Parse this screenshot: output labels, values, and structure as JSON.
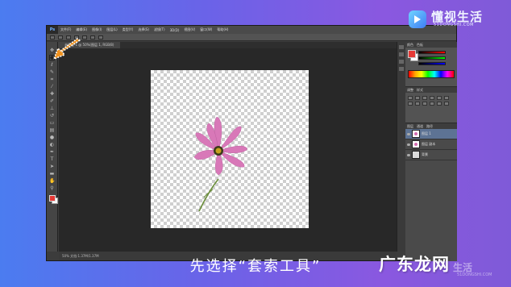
{
  "app": {
    "logo_text": "Ps",
    "menu": [
      "文件(F)",
      "编辑(E)",
      "图像(I)",
      "图层(L)",
      "类型(Y)",
      "选择(S)",
      "滤镜(T)",
      "3D(D)",
      "视图(V)",
      "窗口(W)",
      "帮助(H)"
    ],
    "document_tab": "未标题-1 @ 50%(图层 1, RGB/8)",
    "status": "50% 文档:1.37M/1.37M"
  },
  "panels": {
    "color_tabs": [
      "颜色",
      "色板"
    ],
    "adjust_tabs": [
      "调整",
      "样式"
    ],
    "layers_tabs": [
      "图层",
      "通道",
      "路径"
    ],
    "layers": [
      {
        "name": "图层 1",
        "selected": true
      },
      {
        "name": "图层 副本",
        "selected": false
      },
      {
        "name": "背景",
        "selected": false
      }
    ]
  },
  "branding": {
    "title": "懂视生活",
    "subtitle": "51DONGSHI.COM"
  },
  "caption": "先选择“套索工具”",
  "watermark": {
    "main": "广东龙网",
    "faded": "生活",
    "url": "51DONGSHI.COM"
  },
  "colors": {
    "accent_arrow": "#f0921e",
    "flower_petal": "#d878b8",
    "foreground_swatch": "#e53935"
  }
}
